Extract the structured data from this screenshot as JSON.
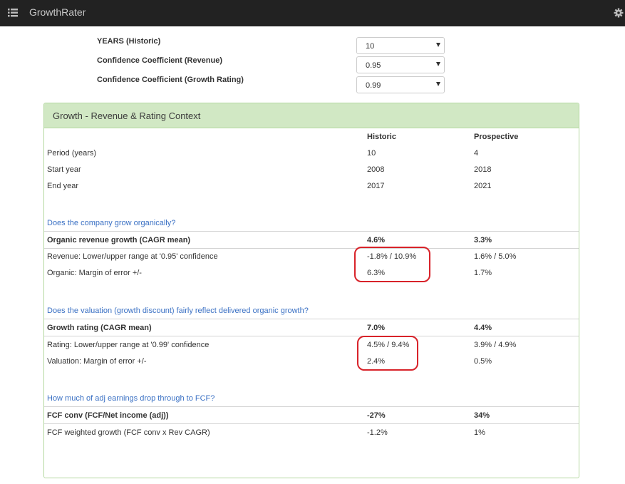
{
  "app": {
    "title": "GrowthRater",
    "menu_icon": "list-icon",
    "settings_icon": "gear-icon"
  },
  "form": {
    "years_label": "YEARS (Historic)",
    "years_value": "10",
    "conf_revenue_label": "Confidence Coefficient (Revenue)",
    "conf_revenue_value": "0.95",
    "conf_rating_label": "Confidence Coefficient (Growth Rating)",
    "conf_rating_value": "0.99"
  },
  "panel": {
    "title": "Growth - Revenue & Rating Context",
    "col_historic": "Historic",
    "col_prospective": "Prospective",
    "period": {
      "label": "Period (years)",
      "historic": "10",
      "prospective": "4"
    },
    "start": {
      "label": "Start year",
      "historic": "2008",
      "prospective": "2018"
    },
    "end": {
      "label": "End year",
      "historic": "2017",
      "prospective": "2021"
    },
    "q1": "Does the company grow organically?",
    "organic": {
      "label": "Organic revenue growth (CAGR mean)",
      "historic": "4.6%",
      "prospective": "3.3%"
    },
    "rev_range": {
      "label": "Revenue: Lower/upper range at '0.95' confidence",
      "historic": "-1.8% / 10.9%",
      "prospective": "1.6% / 5.0%"
    },
    "organic_moe": {
      "label": "Organic: Margin of error +/-",
      "historic": "6.3%",
      "prospective": "1.7%"
    },
    "q2": "Does the valuation (growth discount) fairly reflect delivered organic growth?",
    "rating": {
      "label": "Growth rating (CAGR mean)",
      "historic": "7.0%",
      "prospective": "4.4%"
    },
    "rating_range": {
      "label": "Rating: Lower/upper range at '0.99' confidence",
      "historic": "4.5% / 9.4%",
      "prospective": "3.9% / 4.9%"
    },
    "valuation_moe": {
      "label": "Valuation: Margin of error +/-",
      "historic": "2.4%",
      "prospective": "0.5%"
    },
    "q3": "How much of adj earnings drop through to FCF?",
    "fcf_conv": {
      "label": "FCF conv (FCF/Net income (adj))",
      "historic": "-27%",
      "prospective": "34%"
    },
    "fcf_weighted": {
      "label": "FCF weighted growth (FCF conv x Rev CAGR)",
      "historic": "-1.2%",
      "prospective": "1%"
    }
  },
  "colors": {
    "topbar": "#222222",
    "panel_heading": "#d1e8c4",
    "panel_border": "#b4d8a0",
    "question_link": "#3b71c4",
    "highlight": "#d8232a"
  }
}
